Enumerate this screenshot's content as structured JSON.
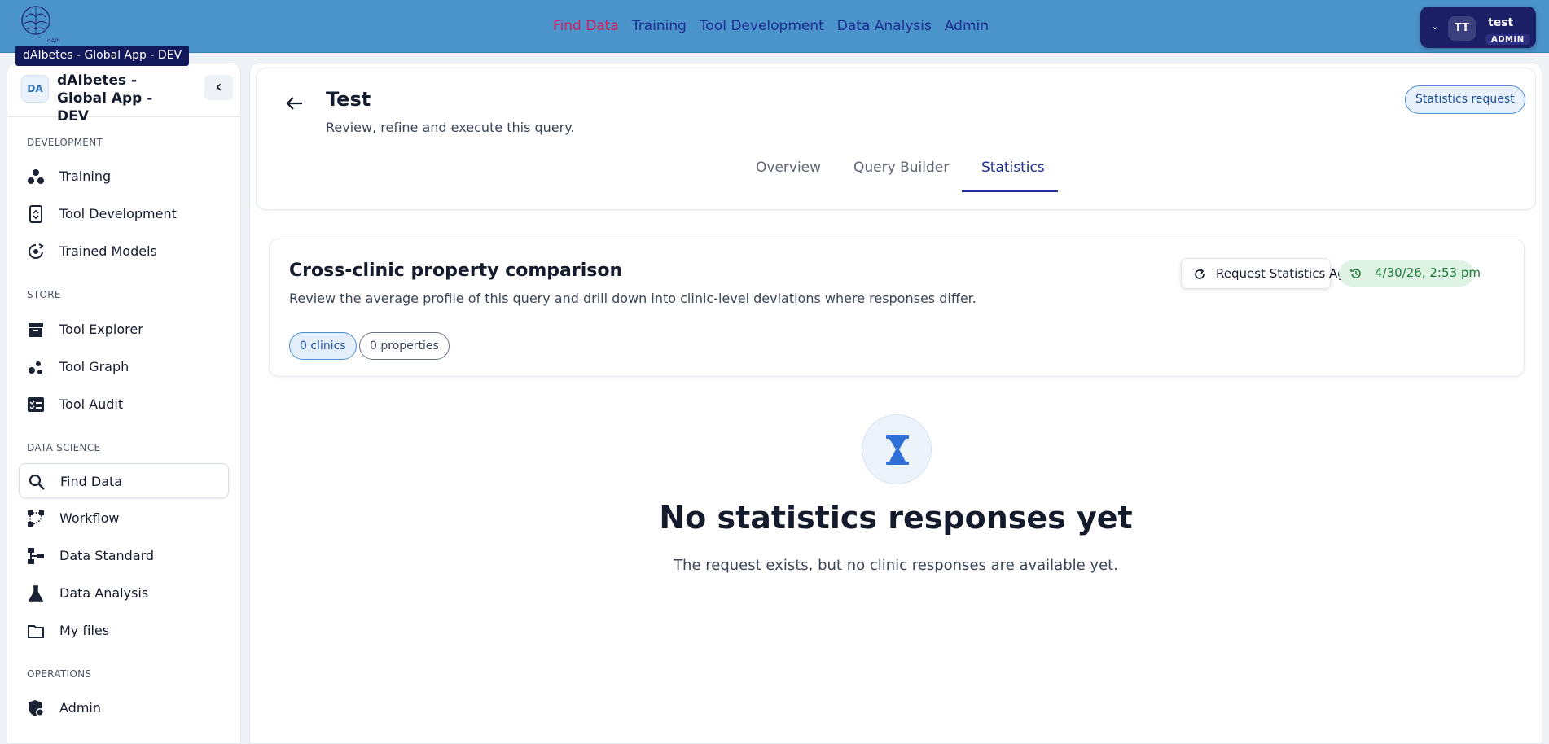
{
  "topbar": {
    "logo_text": "dAIbetes",
    "app_tooltip": "dAIbetes - Global App - DEV",
    "nav": [
      {
        "label": "Find Data",
        "active": true
      },
      {
        "label": "Training"
      },
      {
        "label": "Tool Development"
      },
      {
        "label": "Data Analysis"
      },
      {
        "label": "Admin"
      }
    ],
    "user": {
      "initials": "TT",
      "name": "test",
      "role": "ADMIN"
    }
  },
  "sidebar": {
    "badge": "DA",
    "title": "dAIbetes - Global App - DEV",
    "sections": [
      {
        "label": "DEVELOPMENT",
        "items": [
          {
            "label": "Training",
            "icon": "training-icon"
          },
          {
            "label": "Tool Development",
            "icon": "tool-development-icon"
          },
          {
            "label": "Trained Models",
            "icon": "trained-models-icon"
          }
        ]
      },
      {
        "label": "STORE",
        "items": [
          {
            "label": "Tool Explorer",
            "icon": "archive-icon"
          },
          {
            "label": "Tool Graph",
            "icon": "graph-icon"
          },
          {
            "label": "Tool Audit",
            "icon": "checklist-icon"
          }
        ]
      },
      {
        "label": "DATA SCIENCE",
        "items": [
          {
            "label": "Find Data",
            "icon": "search-icon",
            "active": true
          },
          {
            "label": "Workflow",
            "icon": "workflow-icon"
          },
          {
            "label": "Data Standard",
            "icon": "hierarchy-icon"
          },
          {
            "label": "Data Analysis",
            "icon": "flask-icon"
          },
          {
            "label": "My files",
            "icon": "folder-icon"
          }
        ]
      },
      {
        "label": "OPERATIONS",
        "items": [
          {
            "label": "Admin",
            "icon": "admin-shield-icon"
          }
        ]
      }
    ]
  },
  "header": {
    "title": "Test",
    "subtitle": "Review, refine and execute this query.",
    "badge": "Statistics request",
    "tabs": [
      {
        "label": "Overview"
      },
      {
        "label": "Query Builder"
      },
      {
        "label": "Statistics",
        "active": true
      }
    ]
  },
  "comparison": {
    "title": "Cross-clinic property comparison",
    "subtitle": "Review the average profile of this query and drill down into clinic-level deviations where responses differ.",
    "request_again": "Request Statistics Again",
    "timestamp": "4/30/26, 2:53 pm",
    "chips": {
      "clinics": "0 clinics",
      "properties": "0 properties"
    }
  },
  "empty_state": {
    "title": "No statistics responses yet",
    "message": "The request exists, but no clinic responses are available yet."
  },
  "colors": {
    "topbar": "#4b93cb",
    "brand_navy": "#1f2f8f",
    "active_nav": "#d21f5e",
    "success_green": "#1e7a3a"
  }
}
